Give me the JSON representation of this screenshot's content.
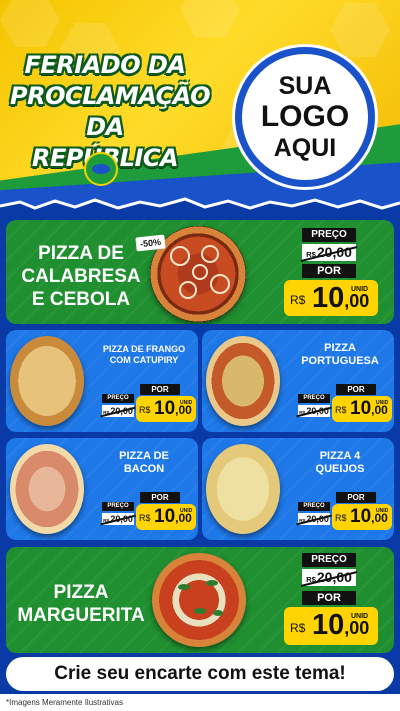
{
  "header": {
    "title_lines": [
      "FERIADO DA",
      "PROCLAMAÇÃO",
      "DA REPÚBLICA"
    ],
    "logo_lines": [
      "SUA",
      "LOGO",
      "AQUI"
    ]
  },
  "currency": "R$",
  "price_label": "PREÇO",
  "por_label": "POR",
  "unit_label": "UNID",
  "featured": {
    "discount": "-50%",
    "name_lines": [
      "PIZZA DE",
      "CALABRESA",
      "E CEBOLA"
    ],
    "old_price": "20,00",
    "price_int": "10",
    "price_dec": ",00"
  },
  "items": [
    {
      "name_lines": [
        "PIZZA DE FRANGO",
        "COM CATUPIRY"
      ],
      "old_price": "20,00",
      "price_int": "10",
      "price_dec": ",00"
    },
    {
      "name_lines": [
        "PIZZA",
        "PORTUGUESA"
      ],
      "old_price": "20,00",
      "price_int": "10",
      "price_dec": ",00"
    },
    {
      "name_lines": [
        "PIZZA DE",
        "BACON"
      ],
      "old_price": "20,00",
      "price_int": "10",
      "price_dec": ",00"
    },
    {
      "name_lines": [
        "PIZZA 4",
        "QUEIJOS"
      ],
      "old_price": "20,00",
      "price_int": "10",
      "price_dec": ",00"
    }
  ],
  "bottom_featured": {
    "name_lines": [
      "PIZZA",
      "MARGUERITA"
    ],
    "old_price": "20,00",
    "price_int": "10",
    "price_dec": ",00"
  },
  "cta": "Crie seu encarte com este tema!",
  "disclaimer": "*Imagens Meramente Ilustrativas",
  "colors": {
    "green": "#1f8f2f",
    "blue": "#1e78e8",
    "yellow": "#ffd400",
    "brand_blue": "#1a52c9"
  }
}
